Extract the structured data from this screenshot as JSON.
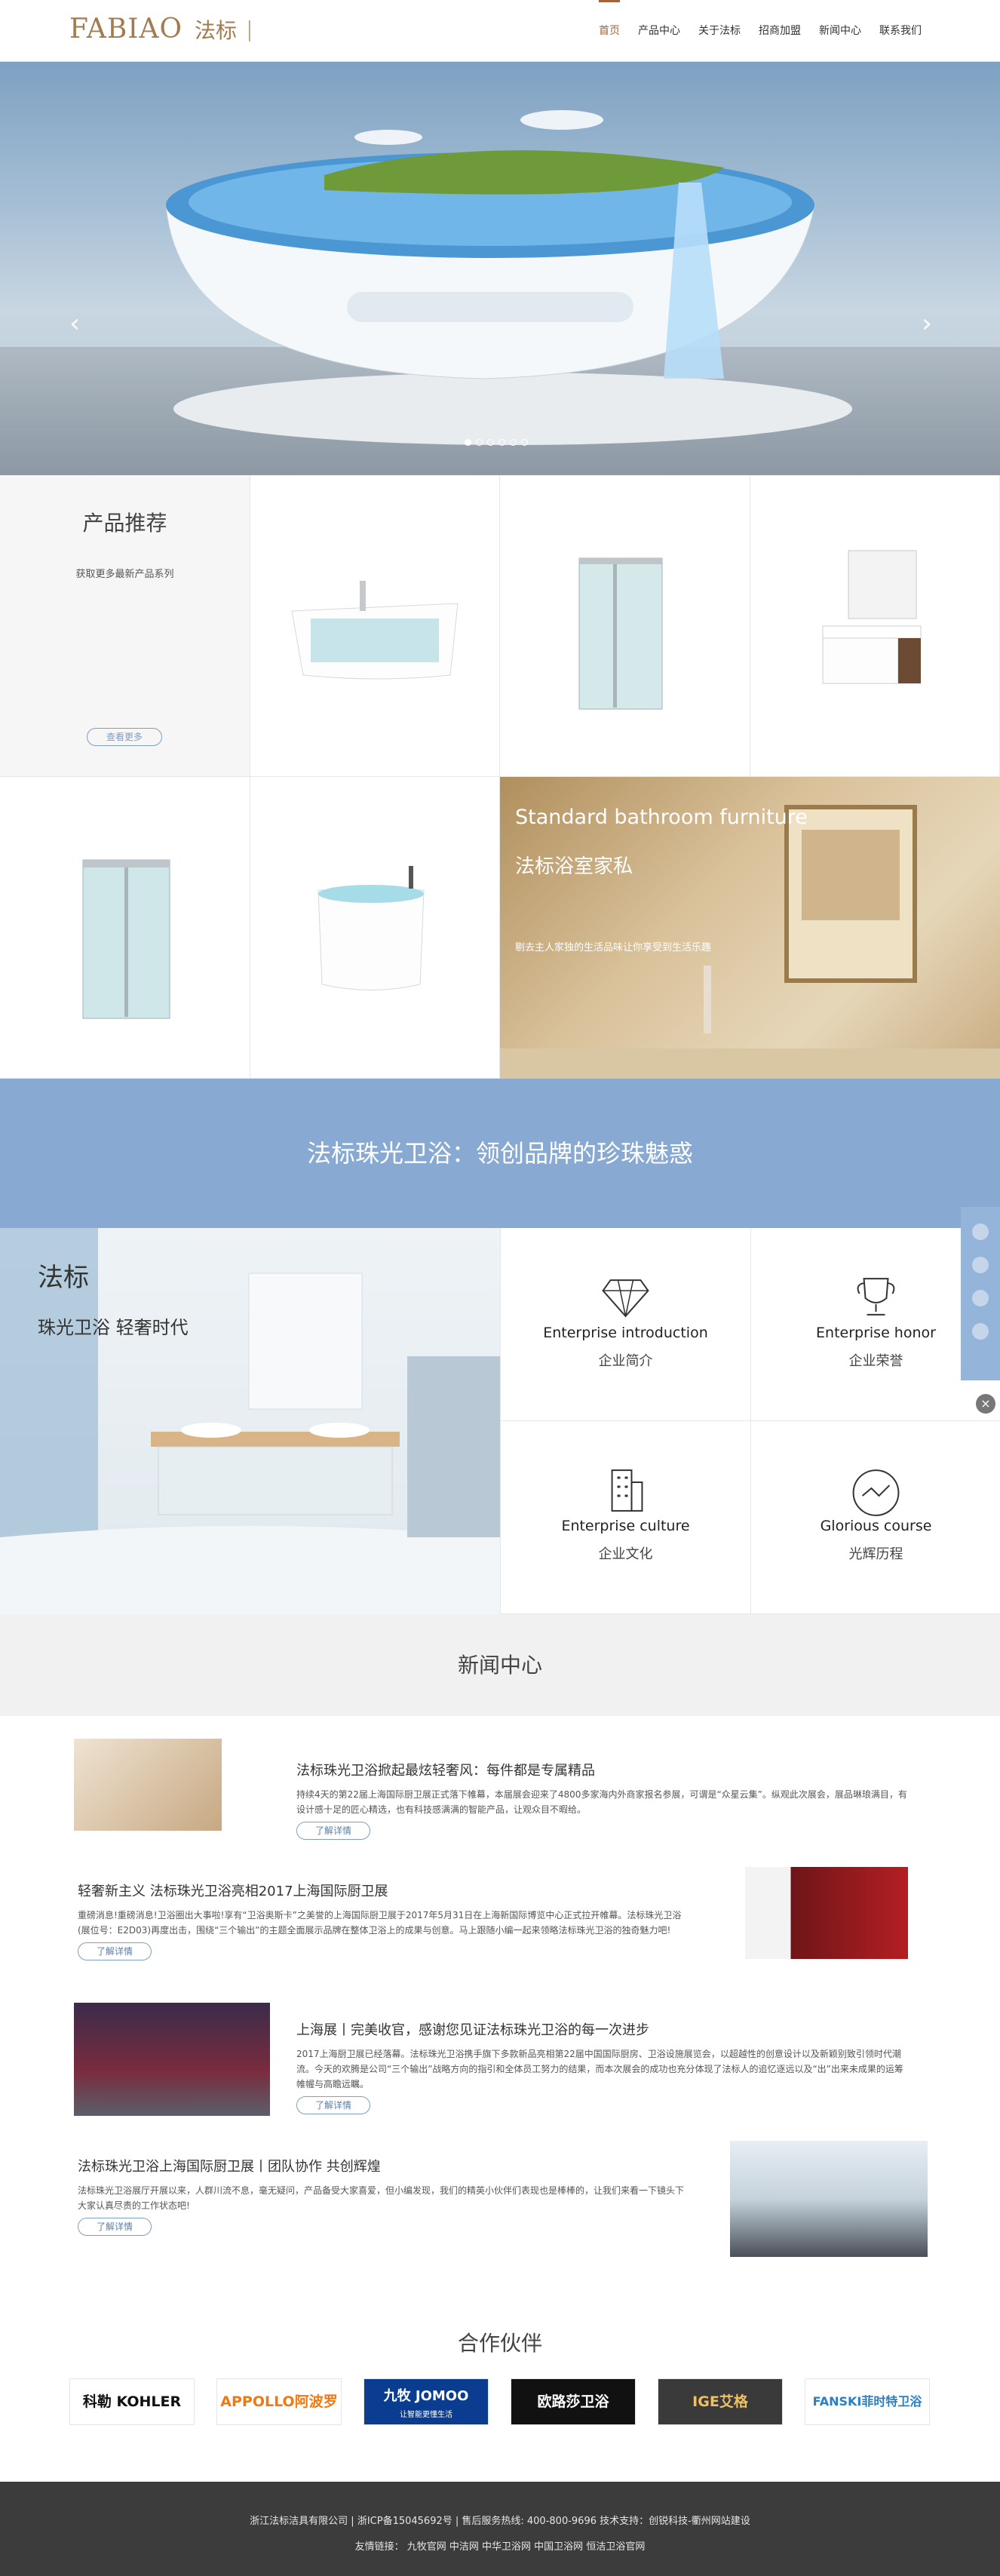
{
  "header": {
    "logo_en": "FABIAO",
    "logo_cn": "法标",
    "logo_bar": "|",
    "nav": [
      "首页",
      "产品中心",
      "关于法标",
      "招商加盟",
      "新闻中心",
      "联系我们"
    ]
  },
  "hero": {
    "prev": "‹",
    "next": "›",
    "dots": 6,
    "active_dot": 1
  },
  "products": {
    "title": "产品推荐",
    "subtitle": "获取更多最新产品系列",
    "more": "查看更多",
    "banner_en": "Standard bathroom furniture",
    "banner_cn": "法标浴室家私",
    "banner_desc": "剔去主人家独的生活品味让你享受到生活乐趣"
  },
  "slogan": "法标珠光卫浴：领创品牌的珍珠魅惑",
  "about": {
    "h1": "法标",
    "h2": "珠光卫浴 轻奢时代",
    "cells": [
      {
        "en": "Enterprise introduction",
        "cn": "企业简介",
        "icon": "diamond-icon"
      },
      {
        "en": "Enterprise honor",
        "cn": "企业荣誉",
        "icon": "trophy-icon"
      },
      {
        "en": "Enterprise culture",
        "cn": "企业文化",
        "icon": "building-icon"
      },
      {
        "en": "Glorious course",
        "cn": "光辉历程",
        "icon": "chart-circle-icon"
      }
    ]
  },
  "news": {
    "title": "新闻中心",
    "more": "了解详情",
    "items": [
      {
        "title": "法标珠光卫浴掀起最炫轻奢风：每件都是专属精品",
        "desc": "持续4天的第22届上海国际厨卫展正式落下帷幕，本届展会迎来了4800多家海内外商家报名参展，可谓是“众星云集”。纵观此次展会，展品琳琅满目，有设计感十足的匠心精选，也有科技感满满的智能产品，让观众目不暇给。"
      },
      {
        "title": "轻奢新主义 法标珠光卫浴亮相2017上海国际厨卫展",
        "desc": "重磅消息!重磅消息!卫浴圈出大事啦!享有“卫浴奥斯卡”之美誉的上海国际厨卫展于2017年5月31日在上海新国际博览中心正式拉开帷幕。法标珠光卫浴(展位号：E2D03)再度出击，围绕“三个输出”的主题全面展示品牌在整体卫浴上的成果与创意。马上跟随小编一起来领略法标珠光卫浴的独奇魅力吧!"
      },
      {
        "title": "上海展丨完美收官，感谢您见证法标珠光卫浴的每一次进步",
        "desc": "2017上海厨卫展已经落幕。法标珠光卫浴携手旗下多款新品亮相第22届中国国际厨房、卫浴设施展览会，以超越性的创意设计以及新颖别致引领时代潮流。今天的欢腾是公司“三个输出”战略方向的指引和全体员工努力的结果，而本次展会的成功也充分体现了法标人的追忆逐远以及“出”出来未成果的运筹帷幄与高瞻远瞩。"
      },
      {
        "title": "法标珠光卫浴上海国际厨卫展丨团队协作 共创辉煌",
        "desc": "法标珠光卫浴展厅开展以来，人群川流不息，毫无疑问，产品备受大家喜爱，但小编发现，我们的精英小伙伴们表现也是棒棒的，让我们来看一下镜头下大家认真尽责的工作状态吧!"
      }
    ]
  },
  "partners": {
    "title": "合作伙伴",
    "logos": [
      "科勒 KOHLER",
      "APPOLLO阿波罗",
      "九牧 JOMOO",
      "欧路莎卫浴",
      "IGE艾格",
      "FANSKI菲时特卫浴"
    ],
    "jomoo_sub": "让智能更懂生活",
    "colors": [
      "#c00000",
      "#f07a10",
      "#0a3d8f",
      "#111111",
      "#3a3a3a",
      "#2a7fc4"
    ]
  },
  "footer": {
    "line1": "浙江法标洁具有限公司 | 浙ICP备15045692号 | 售后服务热线: 400-800-9696 技术支持：创锐科技-衢州网站建设",
    "line2": "友情链接：  九牧官网  中洁网  中华卫浴网  中国卫浴网  恒洁卫浴官网"
  },
  "colors": {
    "accent": "#a6613a",
    "blue": "#87a9d2",
    "gold": "#a27b4f"
  }
}
